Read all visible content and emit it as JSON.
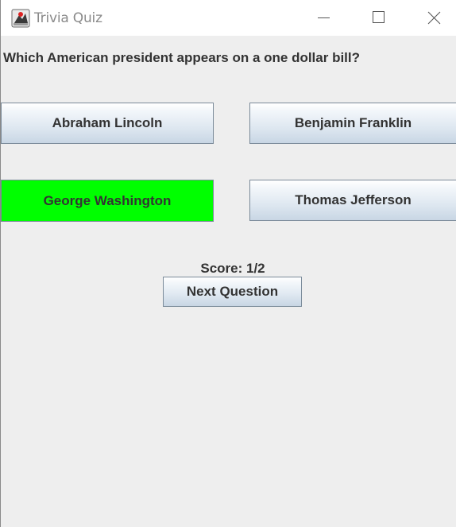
{
  "window": {
    "title": "Trivia Quiz"
  },
  "quiz": {
    "question": "Which American president appears on a one dollar bill?",
    "answers": [
      {
        "label": "Abraham Lincoln",
        "state": "default"
      },
      {
        "label": "Benjamin Franklin",
        "state": "default"
      },
      {
        "label": "George Washington",
        "state": "correct"
      },
      {
        "label": "Thomas Jefferson",
        "state": "default"
      }
    ],
    "score_text": "Score: 1/2",
    "next_label": "Next Question"
  },
  "colors": {
    "correct": "#00ff00",
    "background": "#eeeeee",
    "text": "#333333"
  },
  "icons": [
    "app-icon",
    "minimize-icon",
    "maximize-icon",
    "close-icon"
  ]
}
